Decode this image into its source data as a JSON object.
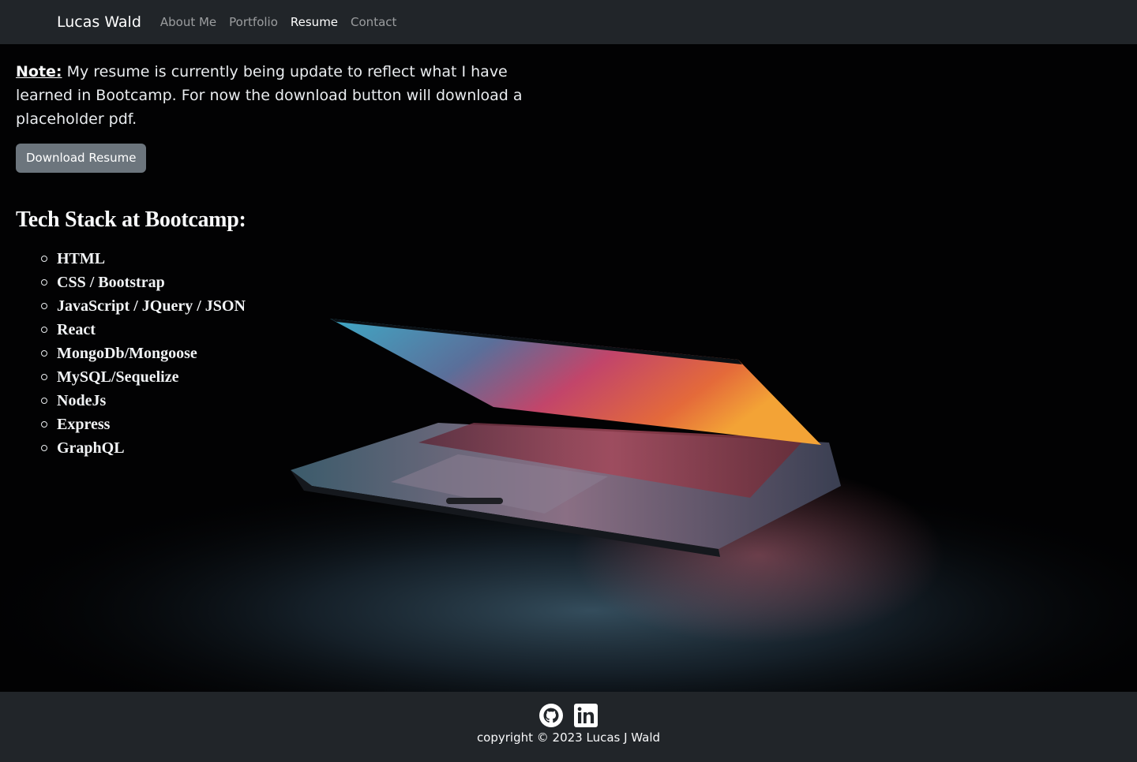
{
  "navbar": {
    "brand": "Lucas Wald",
    "items": [
      {
        "label": "About Me",
        "active": false
      },
      {
        "label": "Portfolio",
        "active": false
      },
      {
        "label": "Resume",
        "active": true
      },
      {
        "label": "Contact",
        "active": false
      }
    ]
  },
  "main": {
    "note_label": "Note:",
    "note_text": " My resume is currently being update to reflect what I have learned in Bootcamp. For now the download button will download a placeholder pdf.",
    "download_label": "Download Resume",
    "stack_title": "Tech Stack at Bootcamp:",
    "stack_items": [
      "HTML",
      "CSS / Bootstrap",
      "JavaScript / JQuery / JSON",
      "React",
      "MongoDb/Mongoose",
      "MySQL/Sequelize",
      "NodeJs",
      "Express",
      "GraphQL"
    ]
  },
  "footer": {
    "icons": [
      "github-icon",
      "linkedin-icon"
    ],
    "copyright": "copyright © 2023 Lucas J Wald"
  },
  "colors": {
    "navbar_bg": "#212529",
    "footer_bg": "#212529",
    "button_bg": "#6c757d",
    "page_bg": "#020203"
  }
}
